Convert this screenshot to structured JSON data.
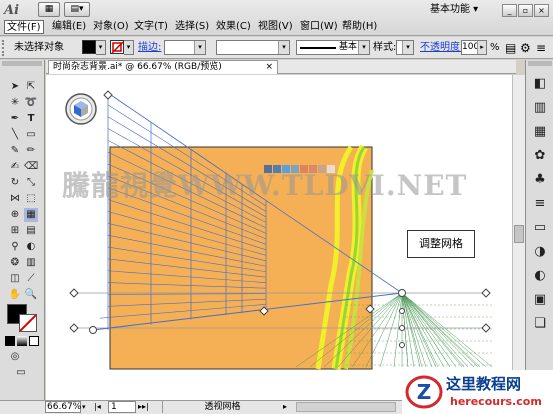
{
  "app": {
    "logo_text": "Ai",
    "workspace": "基本功能"
  },
  "menu": {
    "items": [
      "文件(F)",
      "编辑(E)",
      "对象(O)",
      "文字(T)",
      "选择(S)",
      "效果(C)",
      "视图(V)",
      "窗口(W)",
      "帮助(H)"
    ]
  },
  "control_bar": {
    "selection_status": "未选择对象",
    "stroke_label": "描边:",
    "brush_label": "基本",
    "style_label": "样式:",
    "opacity_label": "不透明度:",
    "opacity_value": "100",
    "opacity_unit": "%"
  },
  "document": {
    "tab_title": "时尚杂志背景.ai* @ 66.67% (RGB/预览)"
  },
  "canvas": {
    "callout_text": "调整网格",
    "watermark": "騰龍視覺WWW.TLDVI.NET",
    "artboard_color": "#f5b055",
    "grid_color_left": "#4a6fc8",
    "grid_color_right": "#4b9a55",
    "swatches": [
      "#5a6e96",
      "#4f7fb0",
      "#5d9fd6",
      "#7aa3c6",
      "#e0825a",
      "#d98a6a",
      "#c8a48c",
      "#e8ddd5"
    ]
  },
  "status_bar": {
    "zoom": "66.67%",
    "page": "1",
    "tool_name": "透视网格"
  },
  "badge": {
    "title": "这里教程网",
    "url": "herecours.com"
  }
}
